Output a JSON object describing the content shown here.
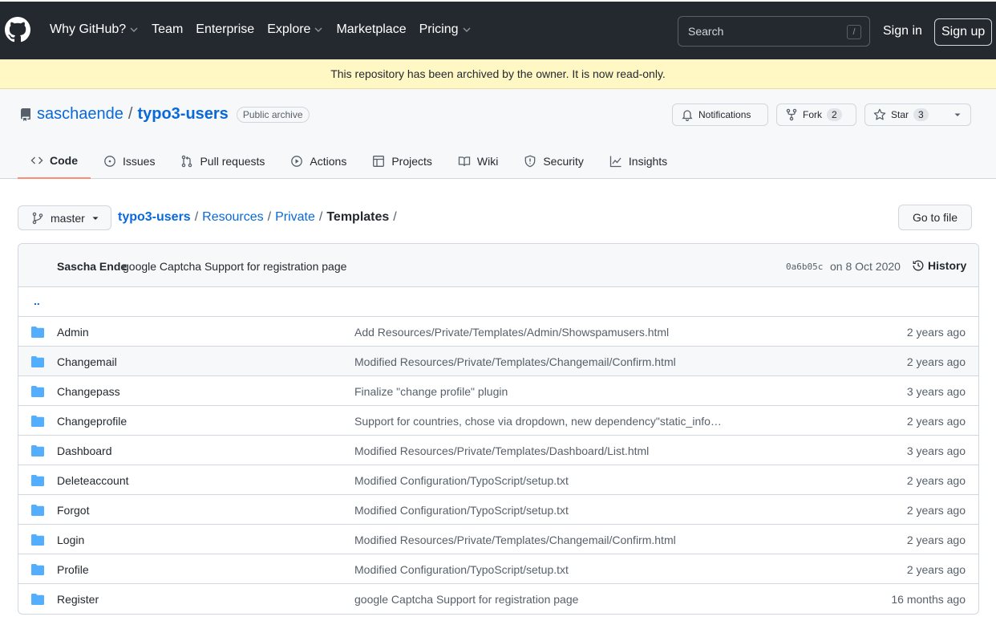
{
  "header": {
    "nav": [
      "Why GitHub?",
      "Team",
      "Enterprise",
      "Explore",
      "Marketplace",
      "Pricing"
    ],
    "nav_dropdown": [
      true,
      false,
      false,
      true,
      false,
      true
    ],
    "search_placeholder": "Search",
    "search_shortcut": "/",
    "signin": "Sign in",
    "signup": "Sign up"
  },
  "banner": "This repository has been archived by the owner. It is now read-only.",
  "repo": {
    "owner": "saschaende",
    "separator": "/",
    "name": "typo3-users",
    "visibility": "Public archive",
    "notifications": "Notifications",
    "fork_label": "Fork",
    "fork_count": "2",
    "star_label": "Star",
    "star_count": "3"
  },
  "tabs": [
    {
      "label": "Code",
      "icon": "code-icon",
      "active": true
    },
    {
      "label": "Issues",
      "icon": "issue-icon",
      "active": false
    },
    {
      "label": "Pull requests",
      "icon": "pull-request-icon",
      "active": false
    },
    {
      "label": "Actions",
      "icon": "play-icon",
      "active": false
    },
    {
      "label": "Projects",
      "icon": "table-icon",
      "active": false
    },
    {
      "label": "Wiki",
      "icon": "book-icon",
      "active": false
    },
    {
      "label": "Security",
      "icon": "shield-icon",
      "active": false
    },
    {
      "label": "Insights",
      "icon": "graph-icon",
      "active": false
    }
  ],
  "branch": "master",
  "breadcrumb": {
    "root": "typo3-users",
    "parts": [
      "Resources",
      "Private"
    ],
    "current": "Templates",
    "sep": "/"
  },
  "go_to_file": "Go to file",
  "commit": {
    "author": "Sascha Ende",
    "message": "google Captcha Support for registration page",
    "sha": "0a6b05c",
    "date": "on 8 Oct 2020",
    "history": "History"
  },
  "updir": "..",
  "files": [
    {
      "name": "Admin",
      "message": "Add Resources/Private/Templates/Admin/Showspamusers.html",
      "age": "2 years ago"
    },
    {
      "name": "Changemail",
      "message": "Modified Resources/Private/Templates/Changemail/Confirm.html",
      "age": "2 years ago"
    },
    {
      "name": "Changepass",
      "message": "Finalize \"change profile\" plugin",
      "age": "3 years ago"
    },
    {
      "name": "Changeprofile",
      "message": "Support for countries, chose via dropdown, new dependency\"static_info…",
      "age": "2 years ago"
    },
    {
      "name": "Dashboard",
      "message": "Modified Resources/Private/Templates/Dashboard/List.html",
      "age": "3 years ago"
    },
    {
      "name": "Deleteaccount",
      "message": "Modified Configuration/TypoScript/setup.txt",
      "age": "2 years ago"
    },
    {
      "name": "Forgot",
      "message": "Modified Configuration/TypoScript/setup.txt",
      "age": "2 years ago"
    },
    {
      "name": "Login",
      "message": "Modified Resources/Private/Templates/Changemail/Confirm.html",
      "age": "2 years ago"
    },
    {
      "name": "Profile",
      "message": "Modified Configuration/TypoScript/setup.txt",
      "age": "2 years ago"
    },
    {
      "name": "Register",
      "message": "google Captcha Support for registration page",
      "age": "16 months ago"
    }
  ],
  "colors": {
    "header_bg": "#24292f",
    "banner_bg": "#fff8c5",
    "link": "#0969da",
    "folder": "#54aeff",
    "tab_underline": "#fd8c73"
  }
}
